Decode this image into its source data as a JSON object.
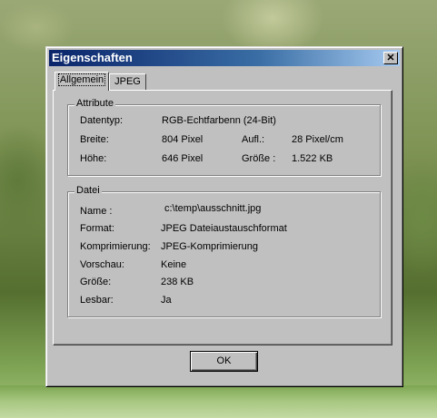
{
  "window": {
    "title": "Eigenschaften",
    "close_glyph": "✕"
  },
  "tabs": [
    {
      "label": "Allgemein",
      "active": true
    },
    {
      "label": "JPEG",
      "active": false
    }
  ],
  "attribute_group": {
    "legend": "Attribute",
    "datentyp_label": "Datentyp:",
    "datentyp_value": "RGB-Echtfarbenn (24-Bit)",
    "breite_label": "Breite:",
    "breite_value": "804 Pixel",
    "aufl_label": "Aufl.:",
    "aufl_value": "28 Pixel/cm",
    "hoehe_label": "Höhe:",
    "hoehe_value": "646 Pixel",
    "groesse_label": "Größe :",
    "groesse_value": "1.522 KB"
  },
  "datei_group": {
    "legend": "Datei",
    "rows": [
      {
        "label": "Name :",
        "value": "c:\\temp\\ausschnitt.jpg"
      },
      {
        "label": "Format:",
        "value": "JPEG Dateiaustauschformat"
      },
      {
        "label": "Komprimierung:",
        "value": "JPEG-Komprimierung"
      },
      {
        "label": "Vorschau:",
        "value": "Keine"
      },
      {
        "label": "Größe:",
        "value": "238 KB"
      },
      {
        "label": "Lesbar:",
        "value": "Ja"
      }
    ]
  },
  "buttons": {
    "ok_label": "OK"
  },
  "colors": {
    "titlebar_start": "#0a246a",
    "titlebar_end": "#a6caf0",
    "dialog_face": "#c0c0c0"
  },
  "icons": {
    "close": "close-icon"
  }
}
